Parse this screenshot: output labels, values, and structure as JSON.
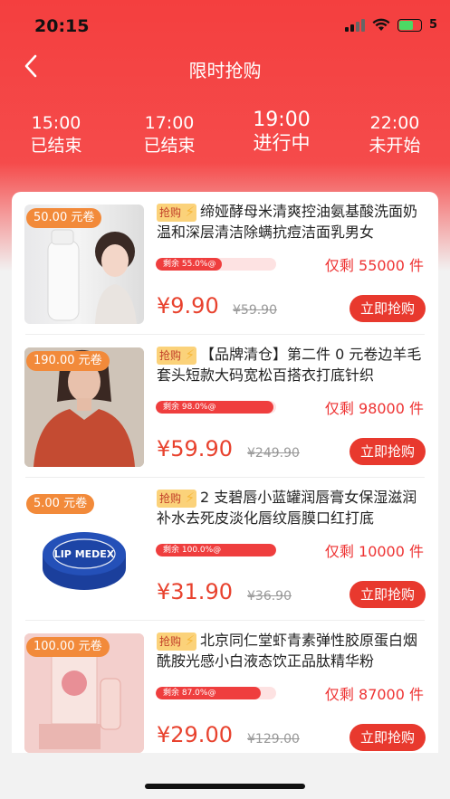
{
  "status_bar": {
    "time": "20:15",
    "battery": "5"
  },
  "header": {
    "title": "限时抢购"
  },
  "tabs": [
    {
      "time": "15:00",
      "status": "已结束"
    },
    {
      "time": "17:00",
      "status": "已结束"
    },
    {
      "time": "19:00",
      "status": "进行中"
    },
    {
      "time": "22:00",
      "status": "未开始"
    }
  ],
  "tag_label": "抢购",
  "buy_label": "立即抢购",
  "items": [
    {
      "coupon": "50.00 元卷",
      "title": "缔娅酵母米清爽控油氨基酸洗面奶温和深层清洁除螨抗痘洁面乳男女",
      "progress_text": "剩余 55.0%@",
      "progress": 0.55,
      "remain": "仅剩 55000 件",
      "price": "¥9.90",
      "orig_price": "¥59.90",
      "thumb_icon": "cleanser-bottle-image"
    },
    {
      "coupon": "190.00 元卷",
      "title": "【品牌清仓】第二件 0 元卷边羊毛套头短款大码宽松百搭衣打底针织",
      "progress_text": "剩余 98.0%@",
      "progress": 0.98,
      "remain": "仅剩 98000 件",
      "price": "¥59.90",
      "orig_price": "¥249.90",
      "thumb_icon": "sweater-model-image"
    },
    {
      "coupon": "5.00 元卷",
      "title": "2 支碧唇小蓝罐润唇膏女保湿滋润补水去死皮淡化唇纹唇膜口红打底",
      "progress_text": "剩余 100.0%@",
      "progress": 1.0,
      "remain": "仅剩 10000 件",
      "price": "¥31.90",
      "orig_price": "¥36.90",
      "thumb_icon": "lip-balm-tin-image",
      "thumb_label": "LIP MEDEX"
    },
    {
      "coupon": "100.00 元卷",
      "title": "北京同仁堂虾青素弹性胶原蛋白烟酰胺光感小白液态饮正品肽精华粉",
      "progress_text": "剩余 87.0%@",
      "progress": 0.87,
      "remain": "仅剩 87000 件",
      "price": "¥29.00",
      "orig_price": "¥129.00",
      "thumb_icon": "collagen-gift-box-image"
    }
  ]
}
